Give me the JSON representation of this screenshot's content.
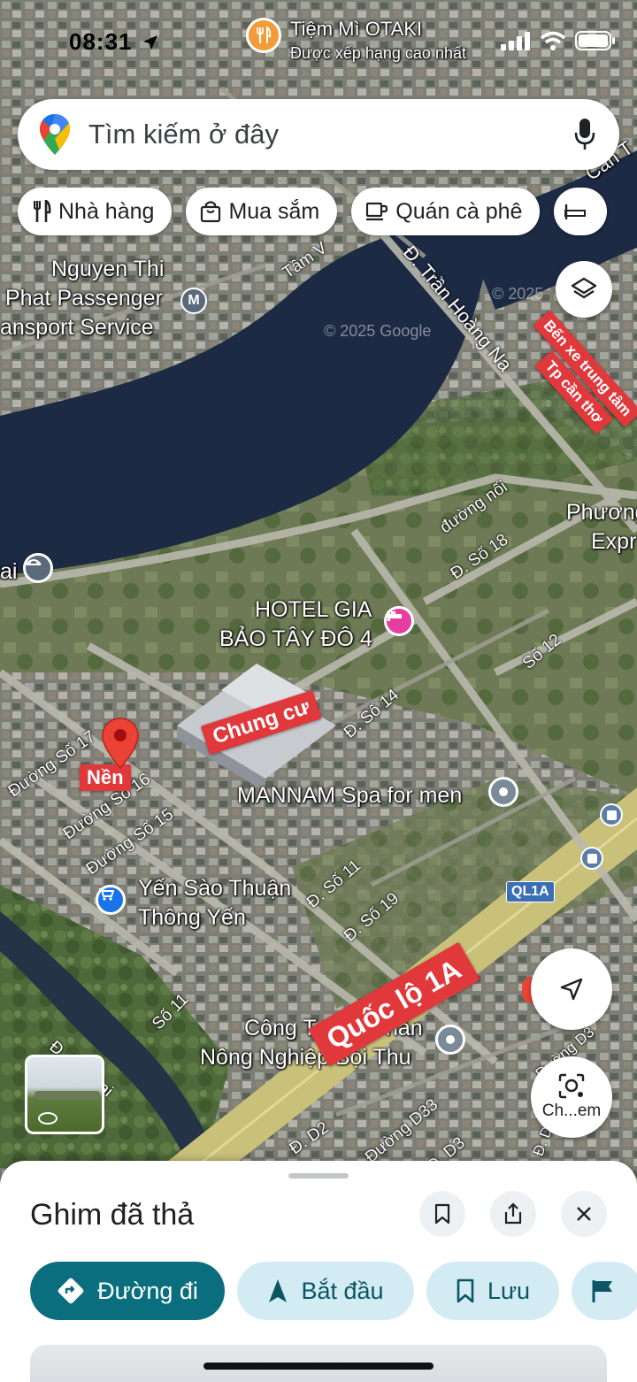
{
  "status_bar": {
    "time": "08:31"
  },
  "top_poi": {
    "name": "Tiệm Mì OTAKI",
    "subtitle": "Được xếp hạng cao nhất"
  },
  "search": {
    "placeholder": "Tìm kiếm ở đây"
  },
  "chips": [
    {
      "label": "Nhà hàng",
      "icon": "fork-knife-icon"
    },
    {
      "label": "Mua sắm",
      "icon": "shopping-bag-icon"
    },
    {
      "label": "Quán cà phê",
      "icon": "coffee-cup-icon"
    }
  ],
  "map": {
    "place_labels": {
      "nguyen_thi_1": "Nguyen Thi",
      "nguyen_thi_2": "Phat Passenger",
      "nguyen_thi_3": "ansport Service",
      "hotel_1": "HOTEL GIA",
      "hotel_2": "BẢO TÂY ĐÔ 4",
      "spa": "MANNAM Spa for men",
      "yen_1": "Yến Sào Thuận",
      "yen_2": "Thông Yến",
      "cong_1": "Công T",
      "cong_1b": "nần",
      "cong_2": "Nông Nghiệp Bội Thu",
      "phuong_1": "Phương",
      "phuong_2": "Expr",
      "ai": "ai",
      "can_tho": "Cần T",
      "copyright_1": "© 2025 Google",
      "copyright_2": "© 2025"
    },
    "road_labels": {
      "tran_hoang_na": "Đ. Trần Hoàng Na",
      "tam_vu": "Tầm V",
      "duong_noi": "đường nối",
      "so_18": "Đ. Số 18",
      "so_12": "Số 12",
      "so_14": "Đ. Số 14",
      "so_17": "Đường Số 17",
      "so_16": "Đường Số 16",
      "so_15": "Đường Số 15",
      "so_11a": "Đ. Số 11",
      "so_19": "Đ. Số 19",
      "so_11b": "Số 11",
      "cai_nai": "Đ. Cái Nai",
      "d2": "Đ. D2",
      "d33": "Đường D33",
      "d3a": "Đ. D3",
      "d3b": "Đường D3",
      "d5": "Đ. D5",
      "ql1a": "QL1A"
    },
    "red_tags": {
      "ben_xe_1": "Bến xe trung tâm",
      "ben_xe_2": "Tp cần thơ",
      "chung_cu": "Chung cư",
      "nen": "Nền",
      "quoc_lo": "Quốc lộ 1A"
    },
    "camera_label": "Ch...em"
  },
  "sheet": {
    "title": "Ghim đã thả",
    "actions": [
      {
        "label": "Đường đi",
        "icon": "directions-icon"
      },
      {
        "label": "Bắt đầu",
        "icon": "navigation-arrow-icon"
      },
      {
        "label": "Lưu",
        "icon": "bookmark-icon"
      }
    ]
  },
  "colors": {
    "accent_teal": "#0b6e7e",
    "secondary_bg": "#d3ecf4",
    "red_tag": "#e0383b",
    "pin_red": "#ea4335",
    "hotel_pink": "#e63ea0",
    "shop_blue": "#1a73e8"
  }
}
